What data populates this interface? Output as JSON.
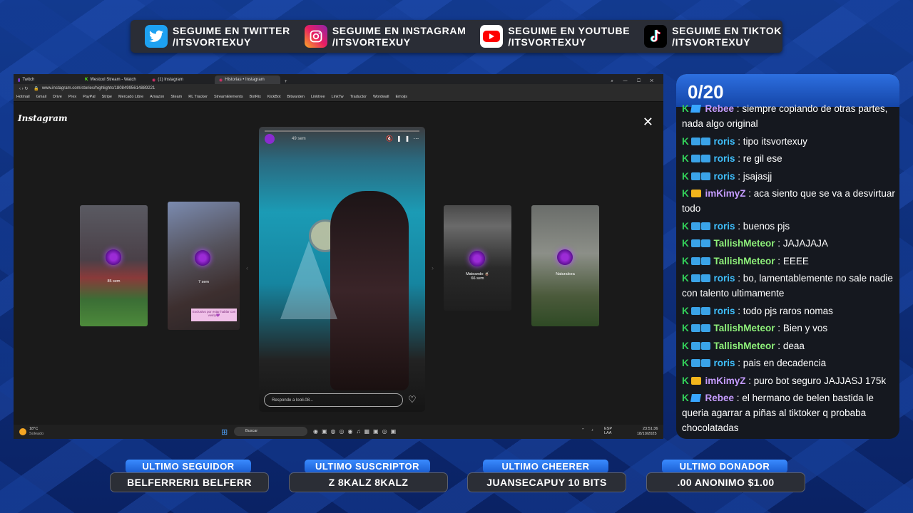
{
  "social": [
    {
      "icon": "twitter-icon",
      "color": "#1da1f2",
      "line1": "SEGUIME EN TWITTER",
      "line2": "/ITSVORTEXUY"
    },
    {
      "icon": "instagram-icon",
      "color": "#d6249f",
      "line1": "SEGUIME EN INSTAGRAM",
      "line2": "/ITSVORTEXUY"
    },
    {
      "icon": "youtube-icon",
      "color": "#ff0000",
      "line1": "SEGUIME EN YOUTUBE",
      "line2": "/ITSVORTEXUY"
    },
    {
      "icon": "tiktok-icon",
      "color": "#000000",
      "line1": "SEGUIME EN TIKTOK",
      "line2": "/ITSVORTEXUY"
    }
  ],
  "browser": {
    "tabs": [
      "Twitch",
      "Westcol Stream - Watch",
      "(1) Instagram",
      "Historias • Instagram"
    ],
    "url": "www.instagram.com/stories/highlights/18084995614889221",
    "bookmarks": [
      "Hotmail",
      "Gmail",
      "Drive",
      "Prex",
      "PayPal",
      "Stripe",
      "Mercado Libre",
      "Amazon",
      "Steam",
      "RL Tracker",
      "StreamElements",
      "BotRix",
      "KickBot",
      "Bitwarden",
      "Linktree",
      "LinkTw",
      "Traductor",
      "Wordwall",
      "Emojis"
    ],
    "instagram_logo": "Instagram",
    "story_time": "49 sem",
    "reply_placeholder": "Responde a looli.08...",
    "side_stories": [
      {
        "label": "85 sem"
      },
      {
        "label": "7 sem"
      },
      {
        "label": "Mateando 🧉\n66 sem"
      },
      {
        "label": "Naturaleza"
      }
    ],
    "sticker_text": "Exclusivo por estar hablar con viviriy💜"
  },
  "taskbar": {
    "weather_temp": "18°C",
    "weather_desc": "Soleado",
    "search_placeholder": "Buscar",
    "lang": "ESP\nLAA",
    "time": "23:51:36",
    "date": "18/10/2025"
  },
  "chat": {
    "counter": "0/20",
    "messages": [
      {
        "badges": "crown-gem",
        "user": "Rebee",
        "color": "#c59cff",
        "text": "siempre copiando de otras partes, nada algo original"
      },
      {
        "badges": "k",
        "user": "roris",
        "color": "#3fc0ff",
        "text": "tipo itsvortexuy"
      },
      {
        "badges": "k",
        "user": "roris",
        "color": "#3fc0ff",
        "text": "re gil ese"
      },
      {
        "badges": "k",
        "user": "roris",
        "color": "#3fc0ff",
        "text": "jsajasjj"
      },
      {
        "badges": "crown",
        "user": "imKimyZ",
        "color": "#c59cff",
        "text": "aca siento que se va a desvirtuar todo"
      },
      {
        "badges": "k",
        "user": "roris",
        "color": "#3fc0ff",
        "text": "buenos pjs"
      },
      {
        "badges": "k",
        "user": "TallishMeteor",
        "color": "#8ef07a",
        "text": "JAJAJAJA"
      },
      {
        "badges": "k",
        "user": "TallishMeteor",
        "color": "#8ef07a",
        "text": "EEEE"
      },
      {
        "badges": "k",
        "user": "roris",
        "color": "#3fc0ff",
        "text": "bo, lamentablemente no sale nadie con talento ultimamente"
      },
      {
        "badges": "k",
        "user": "roris",
        "color": "#3fc0ff",
        "text": "todo pjs raros nomas"
      },
      {
        "badges": "k",
        "user": "TallishMeteor",
        "color": "#8ef07a",
        "text": "Bien y vos"
      },
      {
        "badges": "k",
        "user": "TallishMeteor",
        "color": "#8ef07a",
        "text": "deaa"
      },
      {
        "badges": "k",
        "user": "roris",
        "color": "#3fc0ff",
        "text": "pais en decadencia"
      },
      {
        "badges": "crown",
        "user": "imKimyZ",
        "color": "#c59cff",
        "text": "puro bot seguro JAJJASJ 175k"
      },
      {
        "badges": "gem",
        "user": "Rebee",
        "color": "#c59cff",
        "text": "el hermano de belen bastida le queria agarrar a piñas al tiktoker q probaba chocolatadas"
      }
    ]
  },
  "bottom": [
    {
      "title": "ULTIMO SEGUIDOR",
      "value": "BELFERRERI1      BELFERR"
    },
    {
      "title": "ULTIMO SUSCRIPTOR",
      "value": "Z       8KALZ        8KALZ"
    },
    {
      "title": "ULTIMO CHEERER",
      "value": "JUANSECAPUY 10 BITS"
    },
    {
      "title": "ULTIMO DONADOR",
      "value": ".00          ANONIMO $1.00"
    }
  ]
}
